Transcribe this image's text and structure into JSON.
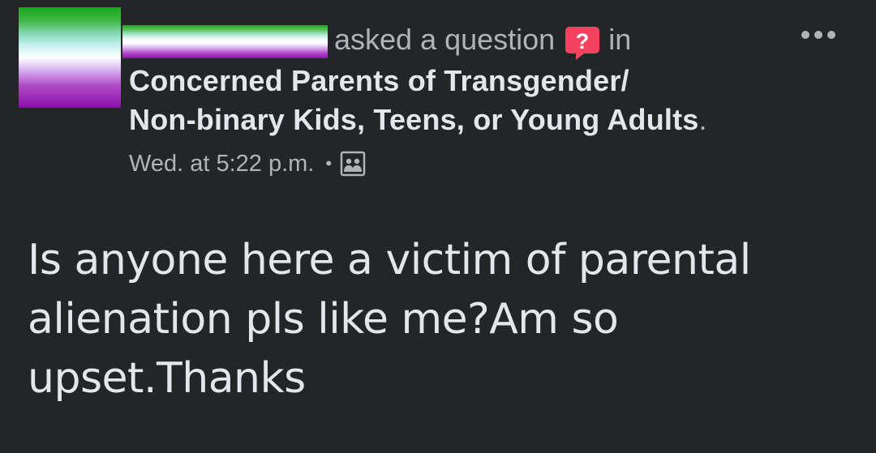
{
  "post": {
    "author_redacted": true,
    "action_text": "asked a question",
    "question_icon": "question-mark-badge-icon",
    "in_text": "in",
    "group_name": "Concerned Parents of Transgender/ Non-binary Kids, Teens, or Young Adults",
    "group_name_line1": "Concerned Parents of Transgender/",
    "group_name_line2": "Non-binary Kids, Teens, or Young Adults",
    "group_name_trailing": ".",
    "timestamp": "Wed. at 5:22 p.m.",
    "separator": "•",
    "privacy_icon": "group-members-icon",
    "more_icon": "more-options-icon",
    "body_text": "Is anyone here a victim of parental alienation pls like me?Am so upset.Thanks"
  },
  "colors": {
    "background": "#242526",
    "primary_text": "#e4e6eb",
    "secondary_text": "#b0b3b8",
    "question_badge": "#f3425f"
  }
}
